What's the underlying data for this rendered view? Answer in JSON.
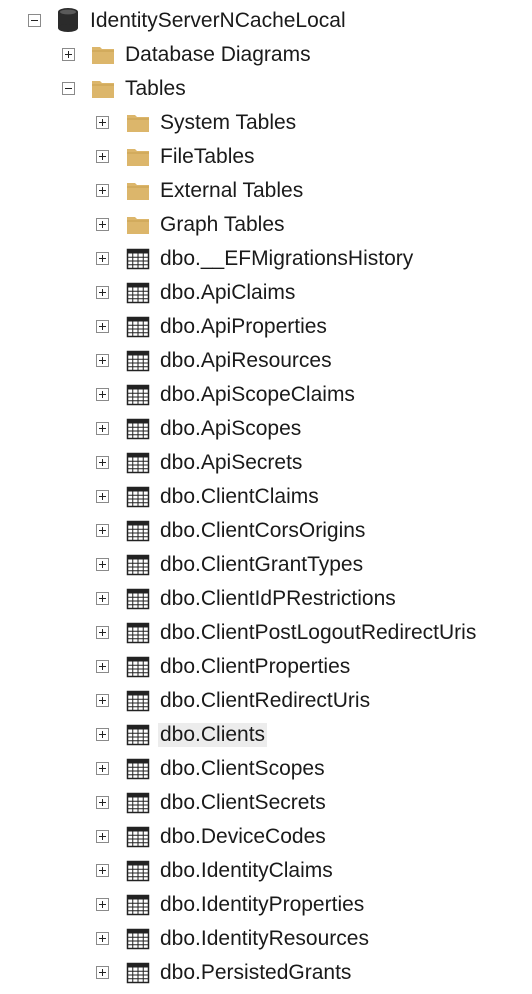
{
  "tree": {
    "server_hint": "",
    "database": {
      "label": "IdentityServerNCacheLocal",
      "expander_icon": "collapse-minus-icon",
      "icon": "database-cylinder-icon"
    },
    "database_diagrams": {
      "label": "Database Diagrams",
      "expander_icon": "expand-plus-icon",
      "icon": "folder-icon"
    },
    "tables_folder": {
      "label": "Tables",
      "expander_icon": "collapse-minus-icon",
      "icon": "folder-icon"
    },
    "subfolders": [
      {
        "label": "System Tables",
        "icon": "folder-icon"
      },
      {
        "label": "FileTables",
        "icon": "folder-icon"
      },
      {
        "label": "External Tables",
        "icon": "folder-icon"
      },
      {
        "label": "Graph Tables",
        "icon": "folder-icon"
      }
    ],
    "tables": [
      {
        "label": "dbo.__EFMigrationsHistory",
        "icon": "table-grid-icon"
      },
      {
        "label": "dbo.ApiClaims",
        "icon": "table-grid-icon"
      },
      {
        "label": "dbo.ApiProperties",
        "icon": "table-grid-icon"
      },
      {
        "label": "dbo.ApiResources",
        "icon": "table-grid-icon"
      },
      {
        "label": "dbo.ApiScopeClaims",
        "icon": "table-grid-icon"
      },
      {
        "label": "dbo.ApiScopes",
        "icon": "table-grid-icon"
      },
      {
        "label": "dbo.ApiSecrets",
        "icon": "table-grid-icon"
      },
      {
        "label": "dbo.ClientClaims",
        "icon": "table-grid-icon"
      },
      {
        "label": "dbo.ClientCorsOrigins",
        "icon": "table-grid-icon"
      },
      {
        "label": "dbo.ClientGrantTypes",
        "icon": "table-grid-icon"
      },
      {
        "label": "dbo.ClientIdPRestrictions",
        "icon": "table-grid-icon"
      },
      {
        "label": "dbo.ClientPostLogoutRedirectUris",
        "icon": "table-grid-icon"
      },
      {
        "label": "dbo.ClientProperties",
        "icon": "table-grid-icon"
      },
      {
        "label": "dbo.ClientRedirectUris",
        "icon": "table-grid-icon"
      },
      {
        "label": "dbo.Clients",
        "icon": "table-grid-icon",
        "highlighted": true
      },
      {
        "label": "dbo.ClientScopes",
        "icon": "table-grid-icon"
      },
      {
        "label": "dbo.ClientSecrets",
        "icon": "table-grid-icon"
      },
      {
        "label": "dbo.DeviceCodes",
        "icon": "table-grid-icon"
      },
      {
        "label": "dbo.IdentityClaims",
        "icon": "table-grid-icon"
      },
      {
        "label": "dbo.IdentityProperties",
        "icon": "table-grid-icon"
      },
      {
        "label": "dbo.IdentityResources",
        "icon": "table-grid-icon"
      },
      {
        "label": "dbo.PersistedGrants",
        "icon": "table-grid-icon"
      }
    ],
    "colors": {
      "folder": "#dcb66b",
      "folder_dark": "#c9a04f",
      "database": "#2b2b2b",
      "highlight": "#ececec",
      "expander_border": "#8a8a8a"
    }
  }
}
